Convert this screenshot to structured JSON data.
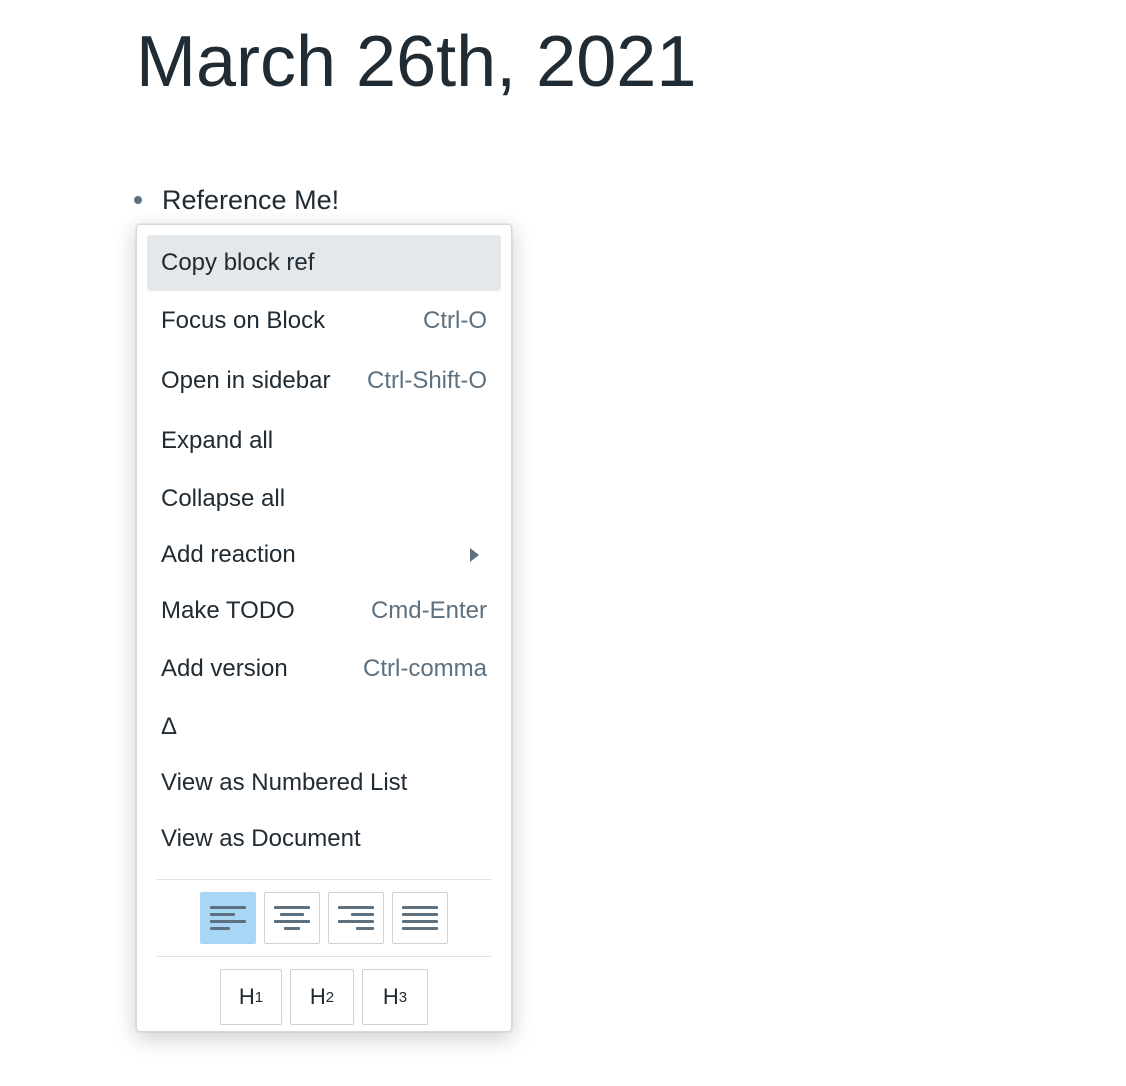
{
  "page": {
    "title": "March 26th, 2021"
  },
  "block": {
    "text": "Reference Me!"
  },
  "context_menu": {
    "items": [
      {
        "label": "Copy block ref",
        "shortcut": ""
      },
      {
        "label": "Focus on Block",
        "shortcut": "Ctrl-O"
      },
      {
        "label": "Open in sidebar",
        "shortcut": "Ctrl-Shift-O"
      },
      {
        "label": "Expand all",
        "shortcut": ""
      },
      {
        "label": "Collapse all",
        "shortcut": ""
      },
      {
        "label": "Add reaction",
        "shortcut": ""
      },
      {
        "label": "Make TODO",
        "shortcut": "Cmd-Enter"
      },
      {
        "label": "Add version",
        "shortcut": "Ctrl-comma"
      },
      {
        "label": "Δ",
        "shortcut": ""
      },
      {
        "label": "View as Numbered List",
        "shortcut": ""
      },
      {
        "label": "View as Document",
        "shortcut": ""
      }
    ],
    "alignment": {
      "options": [
        "align-left",
        "align-center",
        "align-right",
        "align-justify"
      ],
      "selected": "align-left"
    },
    "headings": [
      {
        "letter": "H",
        "level": "1"
      },
      {
        "letter": "H",
        "level": "2"
      },
      {
        "letter": "H",
        "level": "3"
      }
    ]
  },
  "colors": {
    "text": "#202b33",
    "muted": "#5c7080",
    "active_item_bg": "#e4e8eb",
    "selected_align_bg": "#a8d6f5"
  }
}
